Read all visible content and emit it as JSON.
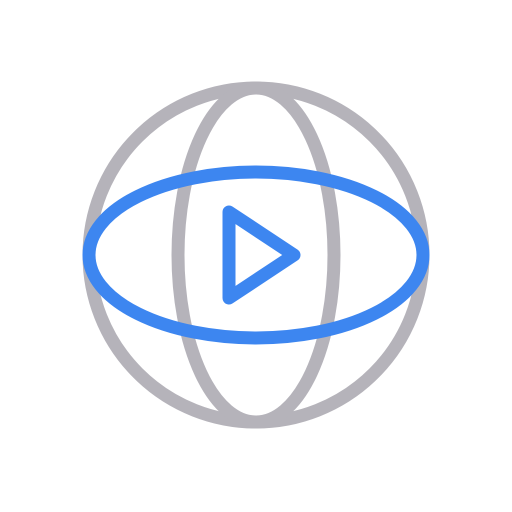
{
  "icon": {
    "name": "globe-video-icon",
    "colors": {
      "globe": "#b5b3ba",
      "accent": "#3d86f0",
      "background": "#ffffff"
    }
  }
}
